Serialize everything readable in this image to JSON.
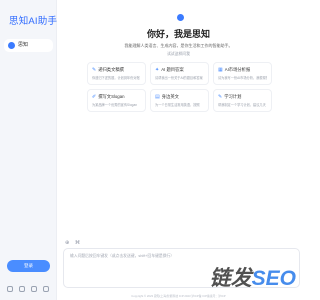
{
  "sidebar": {
    "brand": "思知AI助手",
    "items": [
      {
        "label": "思知"
      }
    ],
    "login_label": "登录",
    "icons": [
      "user-icon",
      "doc-icon",
      "search-icon",
      "settings-icon"
    ]
  },
  "main": {
    "title": "你好，我是思知",
    "description": "我能理解人类语言、生成内容，是你生活和工作的智能助手。",
    "subtitle": "试试这样问我",
    "cards": [
      {
        "icon": "edit-icon",
        "title": "递归类文稿撰",
        "desc": "你递归下述的题，计划到年份对账"
      },
      {
        "icon": "ai-icon",
        "title": "AI 题目答案",
        "desc": "请帮我出一份关于AI的题目和答案"
      },
      {
        "icon": "chart-icon",
        "title": "AI市场分析报",
        "desc": "请为我写一份AI市场分析，我想现在"
      },
      {
        "icon": "pen-icon",
        "title": "撰写文Slogan",
        "desc": "为某品牌一个优秀的宣传Slogan"
      },
      {
        "icon": "book-icon",
        "title": "身边英文",
        "desc": "为一个日常生活常用英语，按照"
      },
      {
        "icon": "study-icon",
        "title": "学习计划",
        "desc": "帮我制定一个学习计划，建议几天"
      }
    ],
    "input_placeholder": "输入问题后按回车键发（或点击发送键，shift+回车键是换行）",
    "footer": "Copyright © 2023 思知(上海)智能科技 ICP:2023 沪ICP备 ICP备案号：沪ICP"
  },
  "watermark": {
    "main": "链发",
    "accent": "SEO"
  }
}
